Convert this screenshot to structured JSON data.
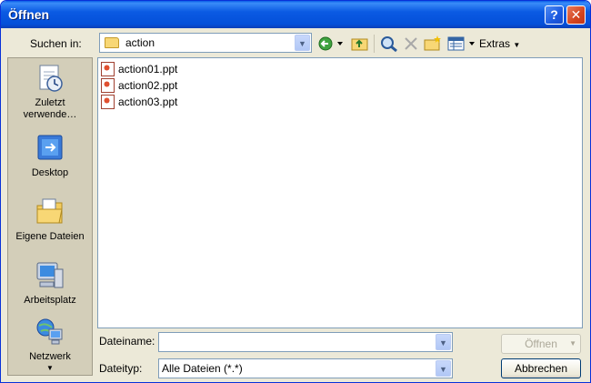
{
  "window": {
    "title": "Öffnen"
  },
  "titlebar": {
    "help_label": "?",
    "close_label": "✕"
  },
  "lookin": {
    "label": "Suchen in:",
    "folder": "action"
  },
  "toolbar": {
    "extras_label": "Extras"
  },
  "places": [
    {
      "label": "Zuletzt verwende…",
      "icon": "recent-documents-icon"
    },
    {
      "label": "Desktop",
      "icon": "desktop-icon"
    },
    {
      "label": "Eigene Dateien",
      "icon": "my-documents-icon"
    },
    {
      "label": "Arbeitsplatz",
      "icon": "my-computer-icon"
    },
    {
      "label": "Netzwerk",
      "icon": "network-icon"
    }
  ],
  "files": [
    {
      "name": "action01.ppt"
    },
    {
      "name": "action02.ppt"
    },
    {
      "name": "action03.ppt"
    }
  ],
  "filename": {
    "label": "Dateiname:",
    "value": ""
  },
  "filetype": {
    "label": "Dateityp:",
    "value": "Alle Dateien (*.*)"
  },
  "buttons": {
    "open": "Öffnen",
    "cancel": "Abbrechen"
  }
}
